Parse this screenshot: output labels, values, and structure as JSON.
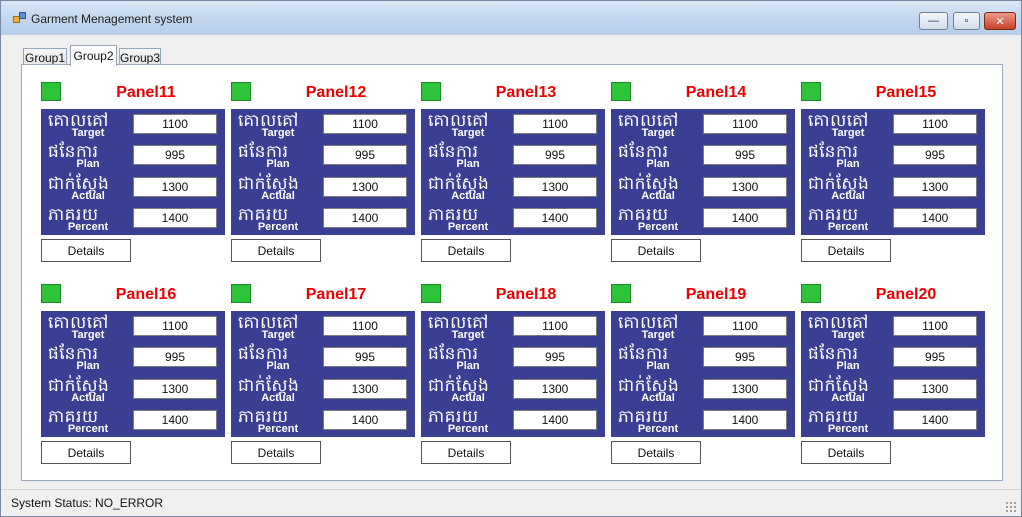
{
  "window": {
    "title": "Garment Menagement system",
    "min_glyph": "—",
    "max_glyph": "▫",
    "close_glyph": "✕",
    "icon": "app-window-icon"
  },
  "tabs": [
    {
      "label": "Group1",
      "active": false
    },
    {
      "label": "Group2",
      "active": true
    },
    {
      "label": "Group3",
      "active": false
    }
  ],
  "row_labels": {
    "target": {
      "kh": "គោលគៅ",
      "en": "Target"
    },
    "plan": {
      "kh": "ផនែការ",
      "en": "Plan"
    },
    "actual": {
      "kh": "ជាក់ស្តែង",
      "en": "Actual"
    },
    "percent": {
      "kh": "ភាគរយ",
      "en": "Percent"
    }
  },
  "details_label": "Details",
  "panels": [
    {
      "name": "Panel11",
      "target": "1100",
      "plan": "995",
      "actual": "1300",
      "percent": "1400"
    },
    {
      "name": "Panel12",
      "target": "1100",
      "plan": "995",
      "actual": "1300",
      "percent": "1400"
    },
    {
      "name": "Panel13",
      "target": "1100",
      "plan": "995",
      "actual": "1300",
      "percent": "1400"
    },
    {
      "name": "Panel14",
      "target": "1100",
      "plan": "995",
      "actual": "1300",
      "percent": "1400"
    },
    {
      "name": "Panel15",
      "target": "1100",
      "plan": "995",
      "actual": "1300",
      "percent": "1400"
    },
    {
      "name": "Panel16",
      "target": "1100",
      "plan": "995",
      "actual": "1300",
      "percent": "1400"
    },
    {
      "name": "Panel17",
      "target": "1100",
      "plan": "995",
      "actual": "1300",
      "percent": "1400"
    },
    {
      "name": "Panel18",
      "target": "1100",
      "plan": "995",
      "actual": "1300",
      "percent": "1400"
    },
    {
      "name": "Panel19",
      "target": "1100",
      "plan": "995",
      "actual": "1300",
      "percent": "1400"
    },
    {
      "name": "Panel20",
      "target": "1100",
      "plan": "995",
      "actual": "1300",
      "percent": "1400"
    }
  ],
  "status": {
    "text": "System Status: NO_ERROR"
  },
  "colors": {
    "panel_bg": "#3a3f93",
    "title_red": "#ee0000",
    "led_green": "#2ec43a"
  }
}
